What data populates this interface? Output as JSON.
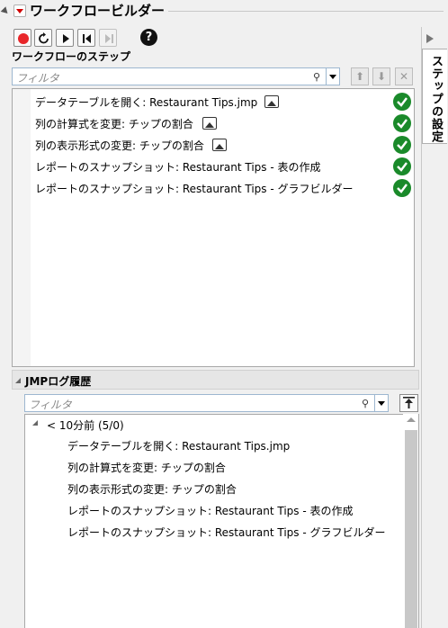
{
  "window": {
    "title": "ワークフロービルダー"
  },
  "toolbar": {
    "record_icon": "record-icon",
    "reset_icon": "reset-icon",
    "play_icon": "play-icon",
    "step_back_icon": "step-back-icon",
    "step_forward_icon": "step-forward-icon",
    "help_label": "?"
  },
  "steps_section": {
    "label": "ワークフローのステップ",
    "filter_placeholder": "フィルタ",
    "move_up_label": "⬆",
    "move_down_label": "⬇",
    "delete_label": "✕",
    "items": [
      {
        "label": "データテーブルを開く: Restaurant Tips.jmp",
        "has_image_icon": true,
        "status": "done"
      },
      {
        "label": "列の計算式を変更: チップの割合",
        "has_image_icon": true,
        "status": "done"
      },
      {
        "label": "列の表示形式の変更: チップの割合",
        "has_image_icon": true,
        "status": "done"
      },
      {
        "label": "レポートのスナップショット: Restaurant Tips - 表の作成",
        "has_image_icon": false,
        "status": "done"
      },
      {
        "label": "レポートのスナップショット: Restaurant Tips - グラフビルダー",
        "has_image_icon": false,
        "status": "done"
      }
    ]
  },
  "side_tab": {
    "label": "ステップの設定"
  },
  "log_section": {
    "label": "JMPログ履歴",
    "filter_placeholder": "フィルタ",
    "group_label": "< 10分前 (5/0)",
    "items": [
      "データテーブルを開く: Restaurant Tips.jmp",
      "列の計算式を変更: チップの割合",
      "列の表示形式の変更: チップの割合",
      "レポートのスナップショット: Restaurant Tips - 表の作成",
      "レポートのスナップショット: Restaurant Tips - グラフビルダー"
    ]
  },
  "colors": {
    "record_red": "#e8262a",
    "check_green": "#1a8a2a",
    "filter_border": "#9db7d0"
  }
}
